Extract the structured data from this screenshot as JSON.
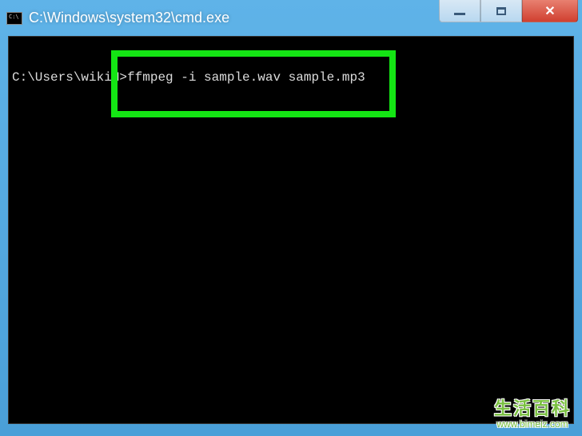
{
  "window": {
    "title": "C:\\Windows\\system32\\cmd.exe",
    "icon_text": "C:\\"
  },
  "controls": {
    "minimize_label": "Minimize",
    "maximize_label": "Maximize",
    "close_label": "Close",
    "close_symbol": "✕"
  },
  "terminal": {
    "prompt": "C:\\Users\\wikiH>",
    "command": "ffmpeg -i sample.wav sample.mp3"
  },
  "watermark": {
    "text_top": "生活百科",
    "text_bottom": "www.bimeiz.com"
  }
}
